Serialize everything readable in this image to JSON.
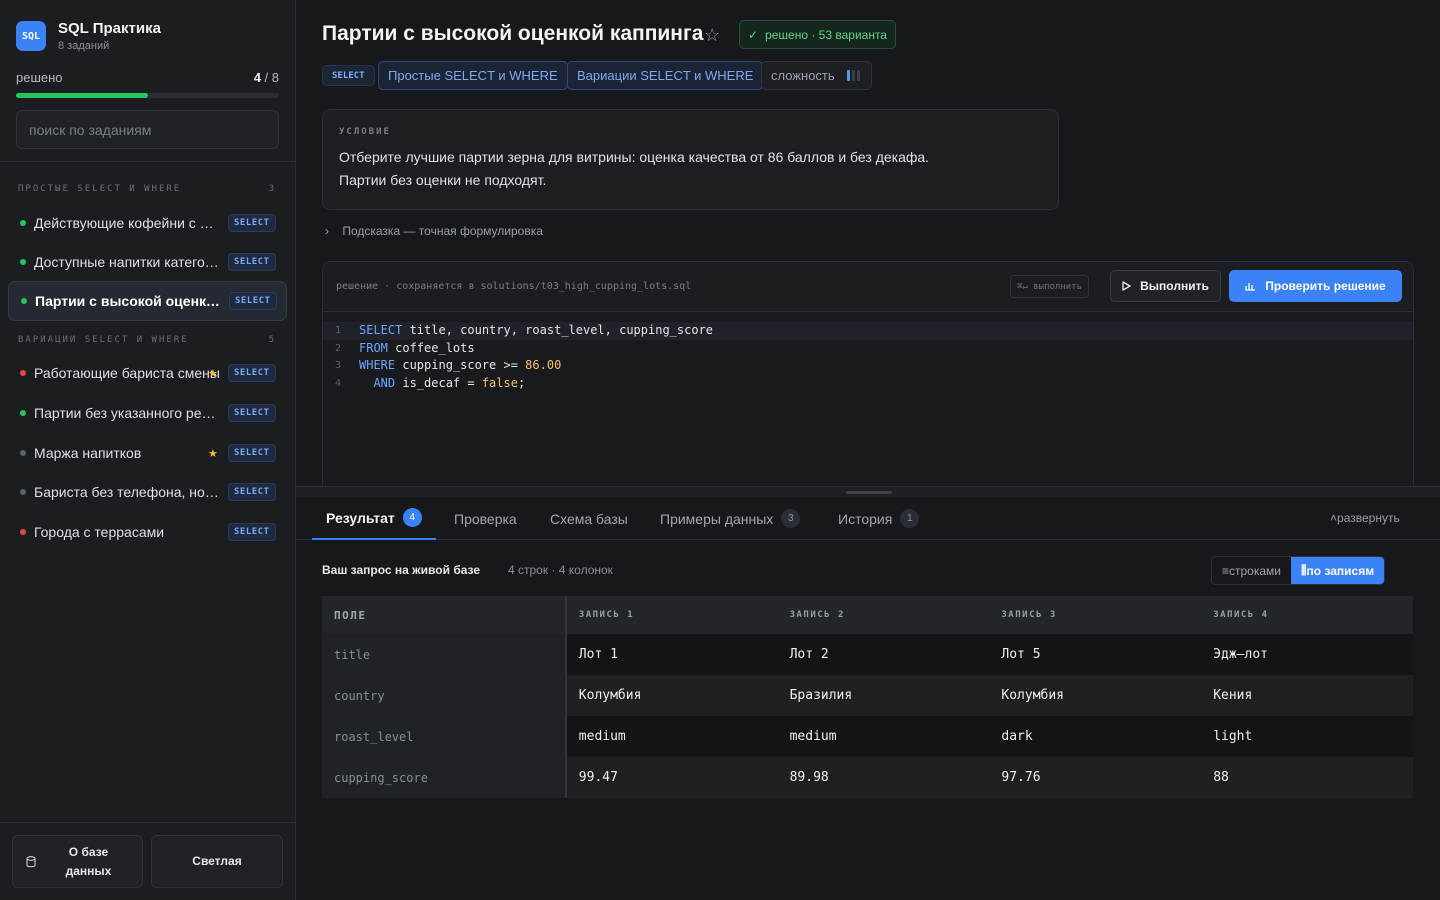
{
  "app": {
    "logo": "SQL",
    "title": "SQL Практика",
    "subtitle": "8 заданий"
  },
  "progress": {
    "label": "решено",
    "solved": "4",
    "total": " / 8",
    "fraction": 0.5
  },
  "search": {
    "placeholder": "поиск по заданиям"
  },
  "groups": [
    {
      "title": "ПРОСТЫЕ SELECT И WHERE",
      "count": "3"
    },
    {
      "title": "ВАРИАЦИИ SELECT И WHERE",
      "count": "5"
    }
  ],
  "tasks": [
    {
      "label": "Действующие кофейни с поддержкой",
      "status": "solved",
      "badge": "SELECT",
      "starred": false,
      "active": false
    },
    {
      "label": "Доступные напитки категории",
      "status": "solved",
      "badge": "SELECT",
      "starred": false,
      "active": false
    },
    {
      "label": "Партии с высокой оценкой каппинга",
      "status": "solved",
      "badge": "SELECT",
      "starred": false,
      "active": true
    },
    {
      "label": "Работающие бариста смены",
      "status": "failed",
      "badge": "SELECT",
      "starred": true,
      "active": false
    },
    {
      "label": "Партии без указанного региона",
      "status": "solved",
      "badge": "SELECT",
      "starred": false,
      "active": false
    },
    {
      "label": "Маржа напитков",
      "status": "none",
      "badge": "SELECT",
      "starred": true,
      "active": false
    },
    {
      "label": "Бариста без телефона, но с email",
      "status": "none",
      "badge": "SELECT",
      "starred": false,
      "active": false
    },
    {
      "label": "Города с террасами",
      "status": "failed",
      "badge": "SELECT",
      "starred": false,
      "active": false
    }
  ],
  "footer": {
    "about_label": "О базе данных",
    "theme_label": "Светлая"
  },
  "task": {
    "title": "Партии с высокой оценкой каппинга",
    "solved_badge": "решено · 53 варианта",
    "keyword_tag": "SELECT",
    "topic_tags": [
      "Простые SELECT и WHERE",
      "Вариации SELECT и WHERE"
    ],
    "difficulty_label": "сложность",
    "difficulty": {
      "level": 1,
      "max": 3
    },
    "condition_heading": "УСЛОВИЕ",
    "condition_lines": [
      "Отберите лучшие партии зерна для витрины: оценка качества от 86 баллов и без декафа.",
      "Партии без оценки не подходят."
    ],
    "hint": "Подсказка — точная формулировка"
  },
  "editor": {
    "path": "решение · сохраняется в solutions/t03_high_cupping_lots.sql",
    "shortcut": "⌘↵ выполнить",
    "run_label": "Выполнить",
    "check_label": "Проверить решение",
    "code": [
      [
        {
          "t": "SELECT",
          "k": "kw"
        },
        {
          "t": " title, country, roast_level, cupping_score",
          "k": "txt"
        }
      ],
      [
        {
          "t": "FROM",
          "k": "kw"
        },
        {
          "t": " coffee_lots",
          "k": "txt"
        }
      ],
      [
        {
          "t": "WHERE",
          "k": "kw"
        },
        {
          "t": " cupping_score >= ",
          "k": "txt"
        },
        {
          "t": "86.00",
          "k": "num"
        }
      ],
      [
        {
          "t": "  AND",
          "k": "kw"
        },
        {
          "t": " is_decaf = ",
          "k": "txt"
        },
        {
          "t": "false",
          "k": "num"
        },
        {
          "t": ";",
          "k": "txt"
        }
      ]
    ]
  },
  "tabs": [
    {
      "label": "Результат",
      "count": "4",
      "active": true
    },
    {
      "label": "Проверка",
      "count": "",
      "active": false
    },
    {
      "label": "Схема базы",
      "count": "",
      "active": false
    },
    {
      "label": "Примеры данных",
      "count": "3",
      "active": false
    },
    {
      "label": "История",
      "count": "1",
      "active": false
    }
  ],
  "expand_label": "развернуть",
  "result": {
    "title": "Ваш запрос на живой базе",
    "meta": "4 строк · 4 колонок",
    "view_rows": "строками",
    "view_records": "по записям",
    "field_header": "ПОЛЕ",
    "record_headers": [
      "ЗАПИСЬ 1",
      "ЗАПИСЬ 2",
      "ЗАПИСЬ 3",
      "ЗАПИСЬ 4"
    ],
    "rows": [
      {
        "field": "title",
        "values": [
          "Лот 1",
          "Лот 2",
          "Лот 5",
          "Эдж–лот"
        ]
      },
      {
        "field": "country",
        "values": [
          "Колумбия",
          "Бразилия",
          "Колумбия",
          "Кения"
        ]
      },
      {
        "field": "roast_level",
        "values": [
          "medium",
          "medium",
          "dark",
          "light"
        ]
      },
      {
        "field": "cupping_score",
        "values": [
          "99.47",
          "89.98",
          "97.76",
          "88"
        ]
      }
    ]
  },
  "colors": {
    "accent": "#3b82f6",
    "solved": "#22c55e",
    "failed": "#ef4444",
    "none": "#5c616a",
    "star": "#f5b83d"
  }
}
